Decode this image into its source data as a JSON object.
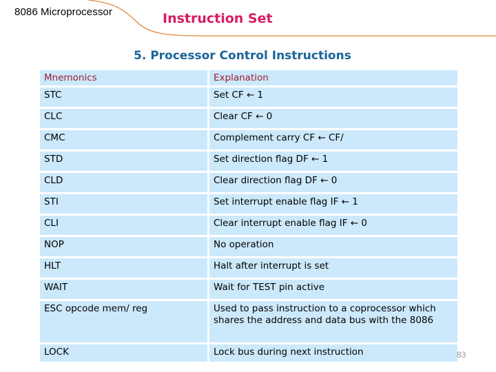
{
  "header": {
    "course_title": "8086 Microprocessor",
    "section_title": "Instruction Set",
    "accent_color": "#d81b60",
    "curve_color": "#e08a3c"
  },
  "slide": {
    "heading": "5. Processor Control Instructions",
    "page_number": "83"
  },
  "table": {
    "columns": [
      "Mnemonics",
      "Explanation"
    ],
    "rows": [
      {
        "mnemonic": "STC",
        "explanation": "Set CF ← 1"
      },
      {
        "mnemonic": "CLC",
        "explanation": "Clear CF ← 0"
      },
      {
        "mnemonic": "CMC",
        "explanation": "Complement carry CF ← CF/"
      },
      {
        "mnemonic": "STD",
        "explanation": "Set direction flag  DF ←  1"
      },
      {
        "mnemonic": "CLD",
        "explanation": "Clear direction flag  DF ←  0"
      },
      {
        "mnemonic": "STI",
        "explanation": "Set interrupt enable flag  IF ←  1"
      },
      {
        "mnemonic": "CLI",
        "explanation": "Clear interrupt enable flag  IF ←  0"
      },
      {
        "mnemonic": "NOP",
        "explanation": "No operation"
      },
      {
        "mnemonic": "HLT",
        "explanation": "Halt after interrupt is set"
      },
      {
        "mnemonic": "WAIT",
        "explanation": "Wait for TEST pin active"
      },
      {
        "mnemonic": "ESC opcode mem/ reg",
        "explanation": "Used to pass instruction to a coprocessor which shares the address and data bus with the 8086"
      },
      {
        "mnemonic": "LOCK",
        "explanation": "Lock bus during next instruction"
      }
    ]
  }
}
